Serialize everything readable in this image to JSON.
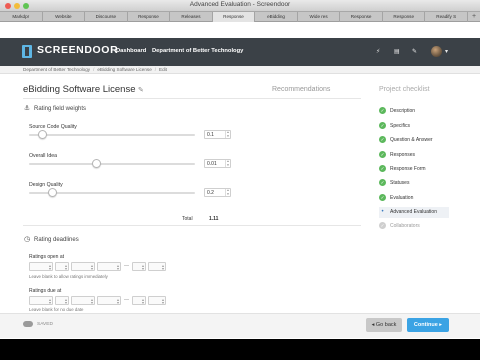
{
  "window": {
    "title": "Advanced Evaluation - Screendoor"
  },
  "tabs": [
    "Markdpr",
    "Website",
    "Discourse",
    "Response",
    "Releases",
    "Response",
    "eBidding",
    "Wide res",
    "Response",
    "Response",
    "Readify S"
  ],
  "tab_add": "+",
  "nav": {
    "brand": "SCREENDOOR",
    "dashboard": "Dashboard",
    "org": "Department of Better Technology",
    "dropdown": "▾"
  },
  "breadcrumb": [
    "Department of Better Technology",
    "eBidding Software License",
    "Edit"
  ],
  "page": {
    "title": "eBidding Software License",
    "recommendations": "Recommendations"
  },
  "weights": {
    "heading": "Rating field weights",
    "fields": [
      {
        "label": "Source Code Quality",
        "value": "0.1",
        "fraction": 0.06
      },
      {
        "label": "Overall Idea",
        "value": "0.01",
        "fraction": 0.4
      },
      {
        "label": "Design Quality",
        "value": "0.2",
        "fraction": 0.12
      }
    ],
    "total_label": "Total",
    "total_value": "1.11"
  },
  "deadlines": {
    "heading": "Rating deadlines",
    "open_label": "Ratings open at",
    "open_hint": "Leave blank to allow ratings immediately",
    "due_label": "Ratings due at",
    "due_hint": "Leave blank for no due date"
  },
  "checklist": {
    "heading": "Project checklist",
    "items": [
      {
        "label": "Description",
        "state": "done"
      },
      {
        "label": "Specifics",
        "state": "done"
      },
      {
        "label": "Question & Answer",
        "state": "done"
      },
      {
        "label": "Responses",
        "state": "done"
      },
      {
        "label": "Response Form",
        "state": "done"
      },
      {
        "label": "Statuses",
        "state": "done"
      },
      {
        "label": "Evaluation",
        "state": "done"
      },
      {
        "label": "Advanced Evaluation",
        "state": "current"
      },
      {
        "label": "Collaborators",
        "state": "todo"
      }
    ]
  },
  "footer": {
    "saved": "SAVED",
    "back": "Go back",
    "continue": "Continue"
  },
  "colors": {
    "nav_bg": "#3b4147",
    "accent": "#3ba3e4",
    "check_green": "#5cb85c"
  }
}
